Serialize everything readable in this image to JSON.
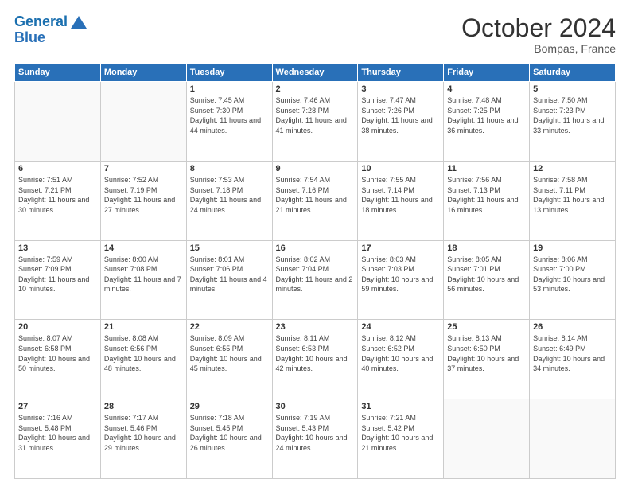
{
  "header": {
    "logo_line1": "General",
    "logo_line2": "Blue",
    "month": "October 2024",
    "location": "Bompas, France"
  },
  "columns": [
    "Sunday",
    "Monday",
    "Tuesday",
    "Wednesday",
    "Thursday",
    "Friday",
    "Saturday"
  ],
  "weeks": [
    [
      {
        "day": "",
        "info": ""
      },
      {
        "day": "",
        "info": ""
      },
      {
        "day": "1",
        "info": "Sunrise: 7:45 AM\nSunset: 7:30 PM\nDaylight: 11 hours and 44 minutes."
      },
      {
        "day": "2",
        "info": "Sunrise: 7:46 AM\nSunset: 7:28 PM\nDaylight: 11 hours and 41 minutes."
      },
      {
        "day": "3",
        "info": "Sunrise: 7:47 AM\nSunset: 7:26 PM\nDaylight: 11 hours and 38 minutes."
      },
      {
        "day": "4",
        "info": "Sunrise: 7:48 AM\nSunset: 7:25 PM\nDaylight: 11 hours and 36 minutes."
      },
      {
        "day": "5",
        "info": "Sunrise: 7:50 AM\nSunset: 7:23 PM\nDaylight: 11 hours and 33 minutes."
      }
    ],
    [
      {
        "day": "6",
        "info": "Sunrise: 7:51 AM\nSunset: 7:21 PM\nDaylight: 11 hours and 30 minutes."
      },
      {
        "day": "7",
        "info": "Sunrise: 7:52 AM\nSunset: 7:19 PM\nDaylight: 11 hours and 27 minutes."
      },
      {
        "day": "8",
        "info": "Sunrise: 7:53 AM\nSunset: 7:18 PM\nDaylight: 11 hours and 24 minutes."
      },
      {
        "day": "9",
        "info": "Sunrise: 7:54 AM\nSunset: 7:16 PM\nDaylight: 11 hours and 21 minutes."
      },
      {
        "day": "10",
        "info": "Sunrise: 7:55 AM\nSunset: 7:14 PM\nDaylight: 11 hours and 18 minutes."
      },
      {
        "day": "11",
        "info": "Sunrise: 7:56 AM\nSunset: 7:13 PM\nDaylight: 11 hours and 16 minutes."
      },
      {
        "day": "12",
        "info": "Sunrise: 7:58 AM\nSunset: 7:11 PM\nDaylight: 11 hours and 13 minutes."
      }
    ],
    [
      {
        "day": "13",
        "info": "Sunrise: 7:59 AM\nSunset: 7:09 PM\nDaylight: 11 hours and 10 minutes."
      },
      {
        "day": "14",
        "info": "Sunrise: 8:00 AM\nSunset: 7:08 PM\nDaylight: 11 hours and 7 minutes."
      },
      {
        "day": "15",
        "info": "Sunrise: 8:01 AM\nSunset: 7:06 PM\nDaylight: 11 hours and 4 minutes."
      },
      {
        "day": "16",
        "info": "Sunrise: 8:02 AM\nSunset: 7:04 PM\nDaylight: 11 hours and 2 minutes."
      },
      {
        "day": "17",
        "info": "Sunrise: 8:03 AM\nSunset: 7:03 PM\nDaylight: 10 hours and 59 minutes."
      },
      {
        "day": "18",
        "info": "Sunrise: 8:05 AM\nSunset: 7:01 PM\nDaylight: 10 hours and 56 minutes."
      },
      {
        "day": "19",
        "info": "Sunrise: 8:06 AM\nSunset: 7:00 PM\nDaylight: 10 hours and 53 minutes."
      }
    ],
    [
      {
        "day": "20",
        "info": "Sunrise: 8:07 AM\nSunset: 6:58 PM\nDaylight: 10 hours and 50 minutes."
      },
      {
        "day": "21",
        "info": "Sunrise: 8:08 AM\nSunset: 6:56 PM\nDaylight: 10 hours and 48 minutes."
      },
      {
        "day": "22",
        "info": "Sunrise: 8:09 AM\nSunset: 6:55 PM\nDaylight: 10 hours and 45 minutes."
      },
      {
        "day": "23",
        "info": "Sunrise: 8:11 AM\nSunset: 6:53 PM\nDaylight: 10 hours and 42 minutes."
      },
      {
        "day": "24",
        "info": "Sunrise: 8:12 AM\nSunset: 6:52 PM\nDaylight: 10 hours and 40 minutes."
      },
      {
        "day": "25",
        "info": "Sunrise: 8:13 AM\nSunset: 6:50 PM\nDaylight: 10 hours and 37 minutes."
      },
      {
        "day": "26",
        "info": "Sunrise: 8:14 AM\nSunset: 6:49 PM\nDaylight: 10 hours and 34 minutes."
      }
    ],
    [
      {
        "day": "27",
        "info": "Sunrise: 7:16 AM\nSunset: 5:48 PM\nDaylight: 10 hours and 31 minutes."
      },
      {
        "day": "28",
        "info": "Sunrise: 7:17 AM\nSunset: 5:46 PM\nDaylight: 10 hours and 29 minutes."
      },
      {
        "day": "29",
        "info": "Sunrise: 7:18 AM\nSunset: 5:45 PM\nDaylight: 10 hours and 26 minutes."
      },
      {
        "day": "30",
        "info": "Sunrise: 7:19 AM\nSunset: 5:43 PM\nDaylight: 10 hours and 24 minutes."
      },
      {
        "day": "31",
        "info": "Sunrise: 7:21 AM\nSunset: 5:42 PM\nDaylight: 10 hours and 21 minutes."
      },
      {
        "day": "",
        "info": ""
      },
      {
        "day": "",
        "info": ""
      }
    ]
  ]
}
